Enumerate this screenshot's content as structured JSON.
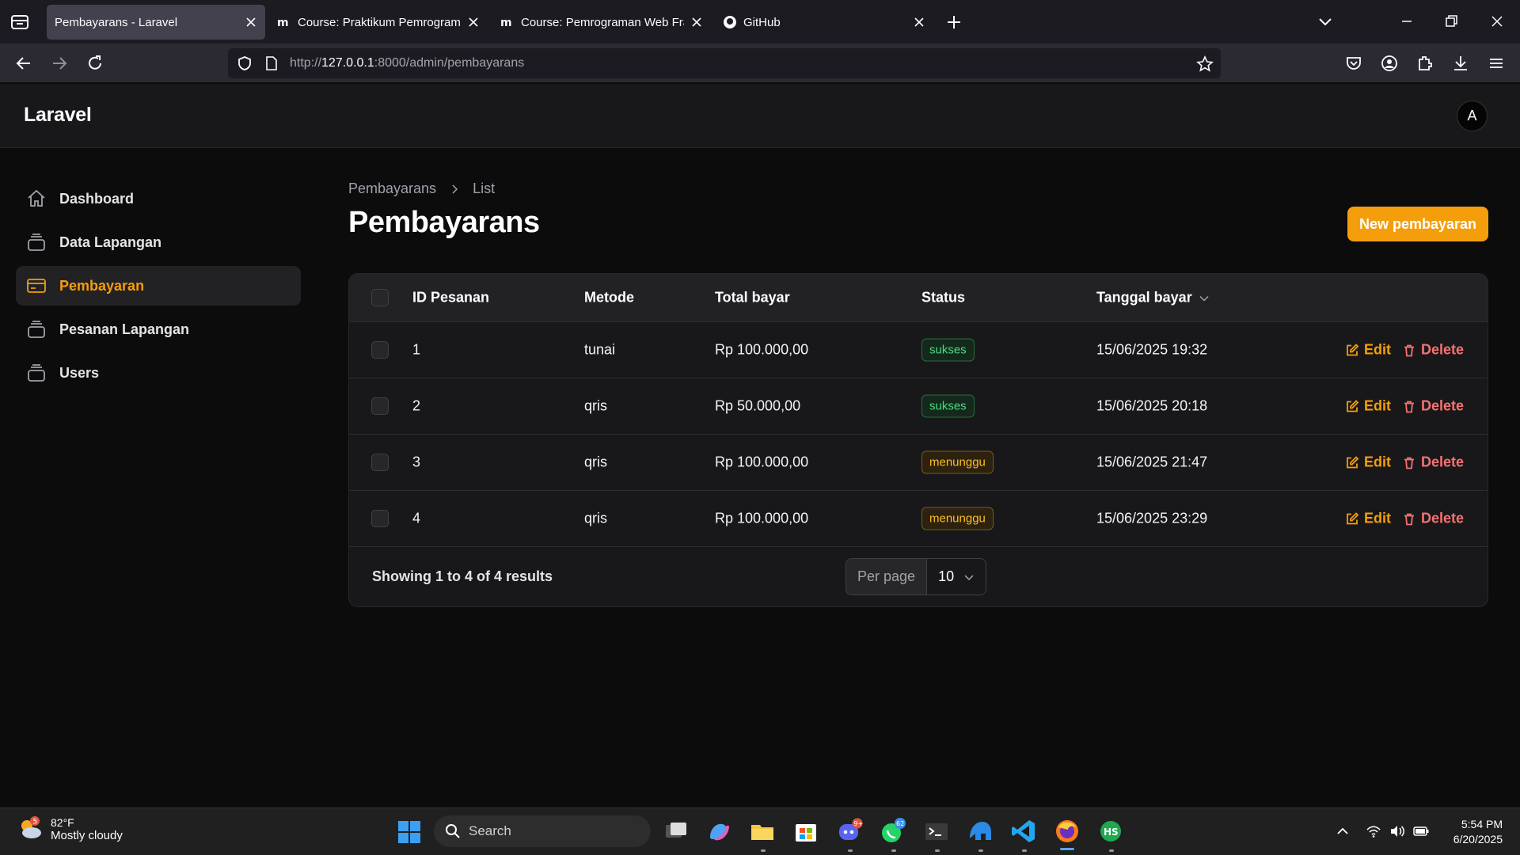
{
  "browser": {
    "tabs": [
      {
        "title": "Pembayarans - Laravel",
        "active": true
      },
      {
        "title": "Course: Praktikum Pemrograma",
        "active": false
      },
      {
        "title": "Course: Pemrograman Web Frar",
        "active": false
      },
      {
        "title": "GitHub",
        "active": false
      }
    ],
    "url_prefix": "http://",
    "url_host": "127.0.0.1",
    "url_rest": ":8000/admin/pembayarans"
  },
  "app": {
    "brand": "Laravel",
    "avatar_initial": "A"
  },
  "sidebar": {
    "items": [
      {
        "label": "Dashboard",
        "icon": "home-icon",
        "active": false
      },
      {
        "label": "Data Lapangan",
        "icon": "rectangle-stack-icon",
        "active": false
      },
      {
        "label": "Pembayaran",
        "icon": "credit-card-icon",
        "active": true
      },
      {
        "label": "Pesanan Lapangan",
        "icon": "rectangle-stack-icon",
        "active": false
      },
      {
        "label": "Users",
        "icon": "rectangle-stack-icon",
        "active": false
      }
    ]
  },
  "page": {
    "breadcrumb": [
      "Pembayarans",
      "List"
    ],
    "title": "Pembayarans",
    "new_button": "New pembayaran"
  },
  "table": {
    "columns": [
      "ID Pesanan",
      "Metode",
      "Total bayar",
      "Status",
      "Tanggal bayar"
    ],
    "rows": [
      {
        "id": "1",
        "metode": "tunai",
        "total": "Rp 100.000,00",
        "status": "sukses",
        "tanggal": "15/06/2025 19:32"
      },
      {
        "id": "2",
        "metode": "qris",
        "total": "Rp 50.000,00",
        "status": "sukses",
        "tanggal": "15/06/2025 20:18"
      },
      {
        "id": "3",
        "metode": "qris",
        "total": "Rp 100.000,00",
        "status": "menunggu",
        "tanggal": "15/06/2025 21:47"
      },
      {
        "id": "4",
        "metode": "qris",
        "total": "Rp 100.000,00",
        "status": "menunggu",
        "tanggal": "15/06/2025 23:29"
      }
    ],
    "edit_label": "Edit",
    "delete_label": "Delete",
    "showing": "Showing 1 to 4 of 4 results",
    "per_page_label": "Per page",
    "per_page_value": "10"
  },
  "taskbar": {
    "weather_badge": "5",
    "weather_temp": "82°F",
    "weather_desc": "Mostly cloudy",
    "search_placeholder": "Search",
    "discord_badge": "9+",
    "whatsapp_badge": "62",
    "time": "5:54 PM",
    "date": "6/20/2025"
  },
  "colors": {
    "accent": "#f59e0b",
    "success": "#4ade80",
    "warning": "#fbbf24",
    "danger": "#f87171"
  }
}
